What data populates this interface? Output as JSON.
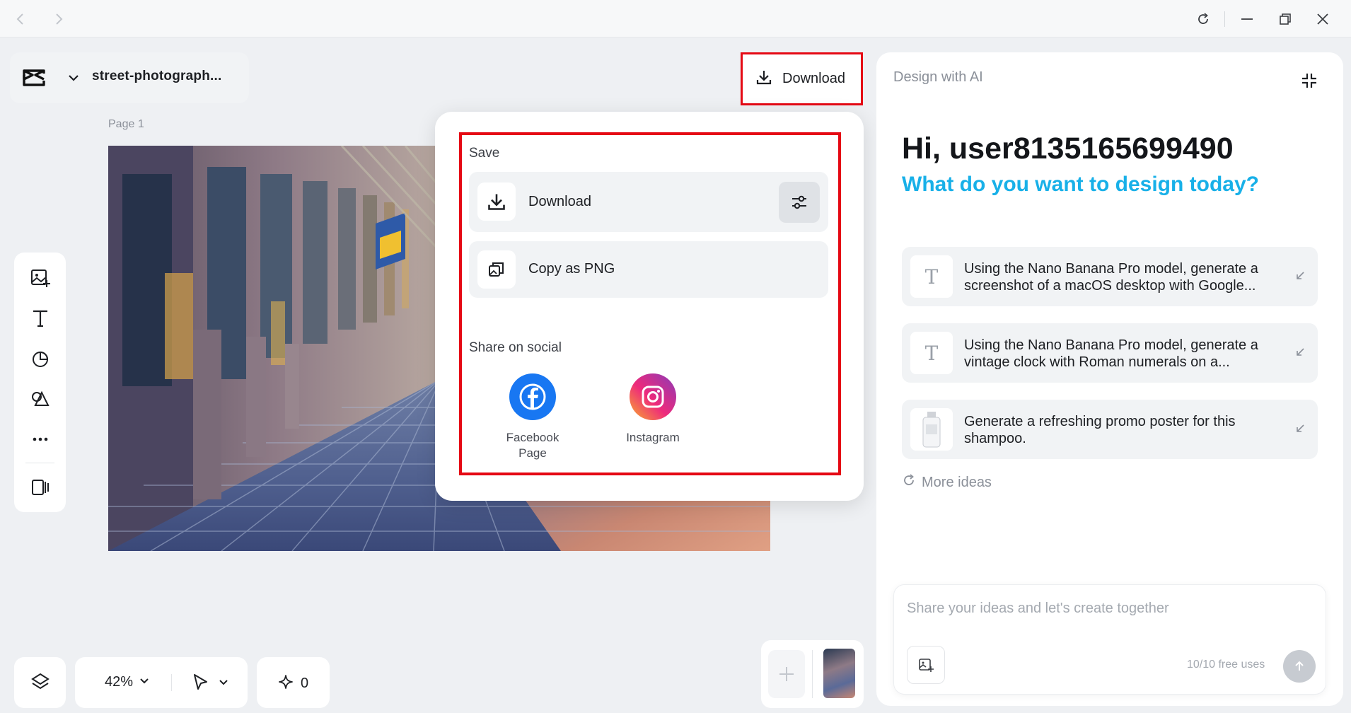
{
  "window": {
    "back_icon": "chevron-left-icon",
    "forward_icon": "chevron-right-icon",
    "controls": [
      "refresh-icon",
      "minimize-icon",
      "restore-icon",
      "close-icon"
    ]
  },
  "header": {
    "file_name": "street-photograph...",
    "logo_icon": "capcut-logo",
    "menu_icon": "chevron-down-icon"
  },
  "canvas": {
    "page_label": "Page 1"
  },
  "toolbar": {
    "download_label": "Download"
  },
  "download_menu": {
    "save_title": "Save",
    "download_label": "Download",
    "copy_label": "Copy as PNG",
    "share_title": "Share on social",
    "social": [
      {
        "label": "Facebook Page",
        "color": "#1877f2"
      },
      {
        "label": "Instagram",
        "color": "#e1306c"
      }
    ],
    "highlight_color": "#e50914"
  },
  "ai_panel": {
    "title": "Design with AI",
    "greeting": "Hi, user8135165699490",
    "subtitle": "What do you want to design today?",
    "ideas": [
      {
        "text": "Using the Nano Banana Pro model, generate a screenshot of a macOS desktop with Google...",
        "thumb": "T"
      },
      {
        "text": "Using the Nano Banana Pro model, generate a vintage clock with Roman numerals on a...",
        "thumb": "T"
      },
      {
        "text": "Generate a refreshing promo poster for this shampoo.",
        "thumb": "shampoo-bottle-image"
      }
    ],
    "more_ideas": "More ideas",
    "prompt_placeholder": "Share your ideas and let's create together",
    "free_uses": "10/10 free uses",
    "accent_color": "#18b0e8"
  },
  "bottom_bar": {
    "zoom": "42%",
    "credits": "0"
  }
}
